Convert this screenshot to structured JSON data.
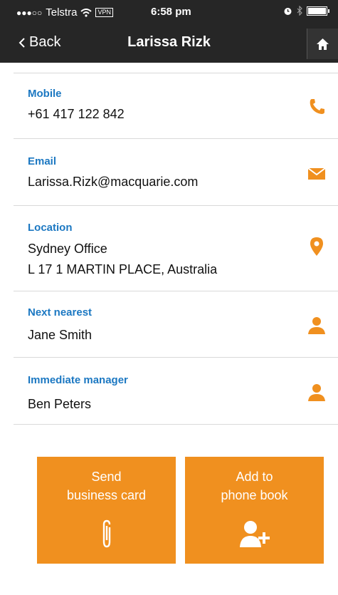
{
  "status_bar": {
    "carrier": "Telstra",
    "vpn": "VPN",
    "time": "6:58 pm"
  },
  "nav": {
    "back_label": "Back",
    "title": "Larissa Rizk"
  },
  "fields": [
    {
      "label": "Mobile",
      "value": "+61 417 122 842",
      "icon": "phone-icon"
    },
    {
      "label": "Email",
      "value": "Larissa.Rizk@macquarie.com",
      "icon": "mail-icon"
    },
    {
      "label": "Location",
      "value": "Sydney Office",
      "value2": "L 17 1 MARTIN PLACE, Australia",
      "icon": "location-pin-icon"
    },
    {
      "label": "Next nearest",
      "value": "Jane Smith",
      "icon": "person-icon"
    },
    {
      "label": "Immediate manager",
      "value": "Ben Peters",
      "icon": "person-icon"
    }
  ],
  "actions": {
    "send_line1": "Send",
    "send_line2": "business card",
    "add_line1": "Add to",
    "add_line2": "phone book"
  },
  "colors": {
    "accent": "#f0901f",
    "label": "#1c78c2",
    "bar": "#262626"
  }
}
